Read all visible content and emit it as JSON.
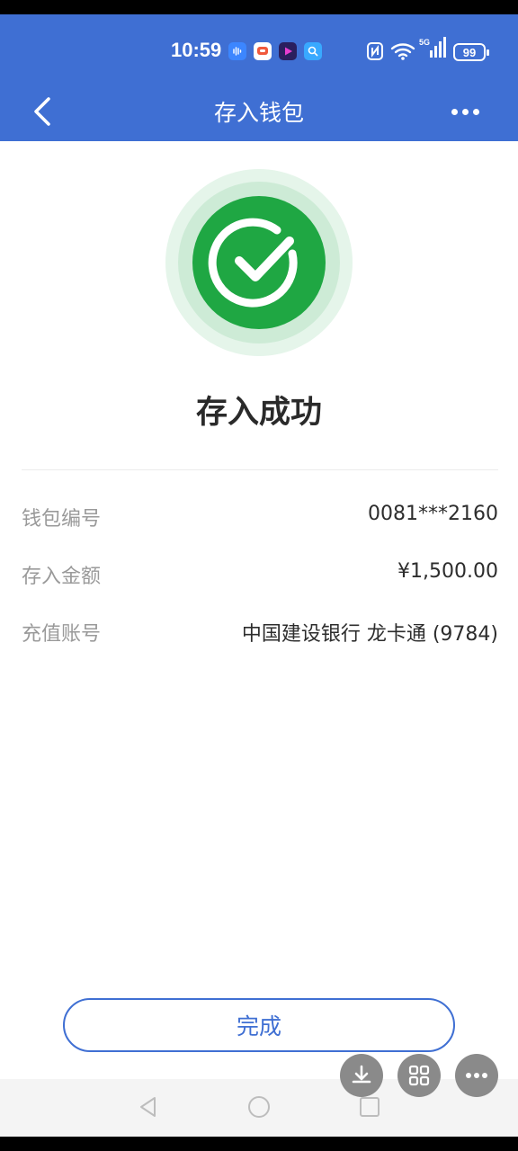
{
  "status_bar": {
    "time": "10:59",
    "network": "5G",
    "battery": "99",
    "icons": [
      "sound-wave-app-icon",
      "chat-app-icon",
      "video-app-icon",
      "search-app-icon",
      "nfc-icon",
      "wifi-icon",
      "signal-icon",
      "battery-icon"
    ]
  },
  "header": {
    "title": "存入钱包",
    "back_icon": "back-arrow-icon",
    "more_icon": "more-dots-icon",
    "background": "#3f6fd3"
  },
  "result": {
    "icon": "success-check-icon",
    "icon_color": "#1fa743",
    "title": "存入成功"
  },
  "details": [
    {
      "label": "钱包编号",
      "value": "0081***2160"
    },
    {
      "label": "存入金额",
      "value": "¥1,500.00"
    },
    {
      "label": "充值账号",
      "value": "中国建设银行 龙卡通 (9784)"
    }
  ],
  "actions": {
    "done_label": "完成"
  },
  "floating_tools": [
    "download-icon",
    "grid-icon",
    "more-icon"
  ],
  "system_nav": [
    "back-triangle-icon",
    "home-circle-icon",
    "recents-square-icon"
  ]
}
